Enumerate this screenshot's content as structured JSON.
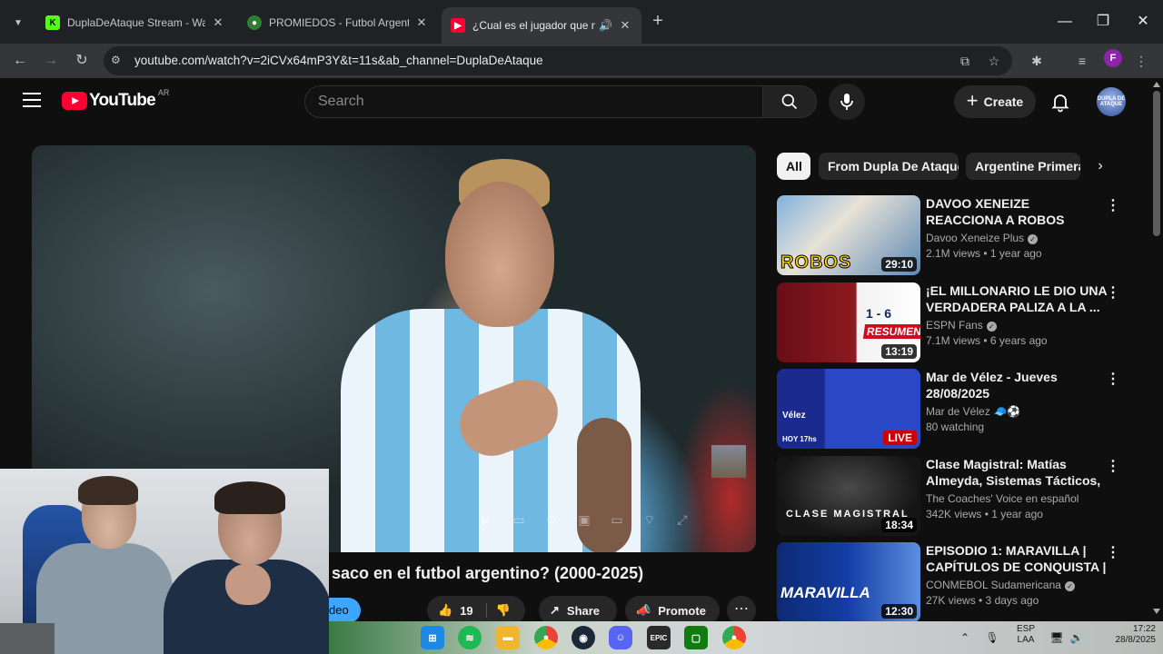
{
  "browser": {
    "tabs": [
      {
        "title": "DuplaDeAtaque Stream - Watch",
        "favicon": "kick-icon",
        "color": "#53fc18"
      },
      {
        "title": "PROMIEDOS - Futbol Argentino",
        "favicon": "promiedos-icon",
        "color": "#2e7d32"
      },
      {
        "title": "¿Cual es el jugador que m",
        "favicon": "youtube-icon",
        "color": "#ff0033",
        "active": true,
        "audio": true
      }
    ],
    "url": "youtube.com/watch?v=2iCVx64mP3Y&t=11s&ab_channel=DuplaDeAtaque",
    "profile_initial": "F"
  },
  "youtube": {
    "logo_text": "YouTube",
    "country": "AR",
    "search_placeholder": "Search",
    "create_label": "Create",
    "avatar_text": "DUPLA DE ATAQUE",
    "video": {
      "title": "saco en el futbol argentino? (2000-2025)",
      "subscribe_fragment": "deo",
      "likes": "19",
      "share_label": "Share",
      "promote_label": "Promote"
    },
    "chips": [
      "All",
      "From Dupla De Ataque",
      "Argentine Primera"
    ],
    "recommendations": [
      {
        "title": "DAVOO XENEIZE REACCIONA A ROBOS ESCANDALOSOS EN E...",
        "channel": "Davoo Xeneize Plus",
        "verified": true,
        "meta": "2.1M views • 1 year ago",
        "duration": "29:10",
        "thumb_text": "ROBOS"
      },
      {
        "title": "¡EL MILLONARIO LE DIO UNA VERDADERA PALIZA A LA ...",
        "channel": "ESPN Fans",
        "verified": true,
        "meta": "7.1M views • 6 years ago",
        "duration": "13:19",
        "thumb_score": "1 - 6",
        "thumb_tag": "RESUMEN"
      },
      {
        "title": "Mar de Vélez - Jueves 28/08/2025",
        "channel": "Mar de Vélez 🧢⚽",
        "verified": false,
        "meta": "80 watching",
        "live": "LIVE",
        "thumb_text": "Vélez",
        "thumb_time": "HOY 17hs"
      },
      {
        "title": "Clase Magistral: Matías Almeyda, Sistemas Tácticos, ...",
        "channel": "The Coaches' Voice en español",
        "verified": false,
        "meta": "342K views • 1 year ago",
        "duration": "18:34",
        "thumb_text": "CLASE MAGISTRAL"
      },
      {
        "title": "EPISODIO 1: MARAVILLA | CAPÍTULOS DE CONQUISTA | ...",
        "channel": "CONMEBOL Sudamericana",
        "verified": true,
        "meta": "27K views • 3 days ago",
        "duration": "12:30",
        "thumb_text": "MARAVILLA"
      }
    ]
  },
  "taskbar": {
    "apps": [
      "windows-start",
      "spotify",
      "file-explorer",
      "chrome",
      "steam",
      "discord",
      "epic-games",
      "xbox",
      "chrome-profile"
    ],
    "lang_top": "ESP",
    "lang_bottom": "LAA",
    "time": "17:22",
    "date": "28/8/2025"
  },
  "colors": {
    "background": "#0f0f0f",
    "accent_red": "#ff0033",
    "link_blue": "#3ea6ff"
  }
}
